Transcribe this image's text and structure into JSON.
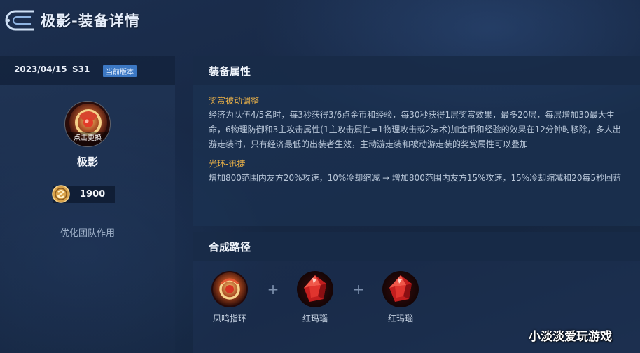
{
  "header": {
    "title": "极影-装备详情",
    "back_icon": "back-arrow-icon"
  },
  "left_panel": {
    "version_date": "2023/04/15",
    "version_season": "S31",
    "version_badge": "当前版本",
    "portrait_caption": "点击更换",
    "item_name": "极影",
    "price": "1900",
    "price_icon": "gold-coin-icon",
    "description": "优化团队作用"
  },
  "attributes": {
    "heading": "装备属性",
    "entries": [
      {
        "name": "奖赏被动调整",
        "text": "经济为队伍4/5名时，每3秒获得3/6点金币和经验，每30秒获得1层奖赏效果，最多20层，每层增加30最大生命，6物理防御和3主攻击属性(1主攻击属性=1物理攻击或2法术)加金币和经验的效果在12分钟时移除，多人出游走装时，只有经济最低的出装者生效，主动游走装和被动游走装的奖赏属性可以叠加"
      },
      {
        "name": "光环-迅捷",
        "text": "增加800范围内友方20%攻速，10%冷却缩减 → 增加800范围内友方15%攻速，15%冷却缩减和20每5秒回蓝"
      }
    ]
  },
  "recipe": {
    "heading": "合成路径",
    "items": [
      {
        "label": "凤鸣指环",
        "icon": "phoenix-ring-icon"
      },
      {
        "label": "红玛瑙",
        "icon": "red-agate-icon"
      },
      {
        "label": "红玛瑙",
        "icon": "red-agate-icon"
      }
    ],
    "plus": "+"
  },
  "watermark": "小淡淡爱玩游戏",
  "colors": {
    "accent_gold": "#e8b048",
    "badge_blue": "#3c78c4",
    "background": "#172845"
  }
}
